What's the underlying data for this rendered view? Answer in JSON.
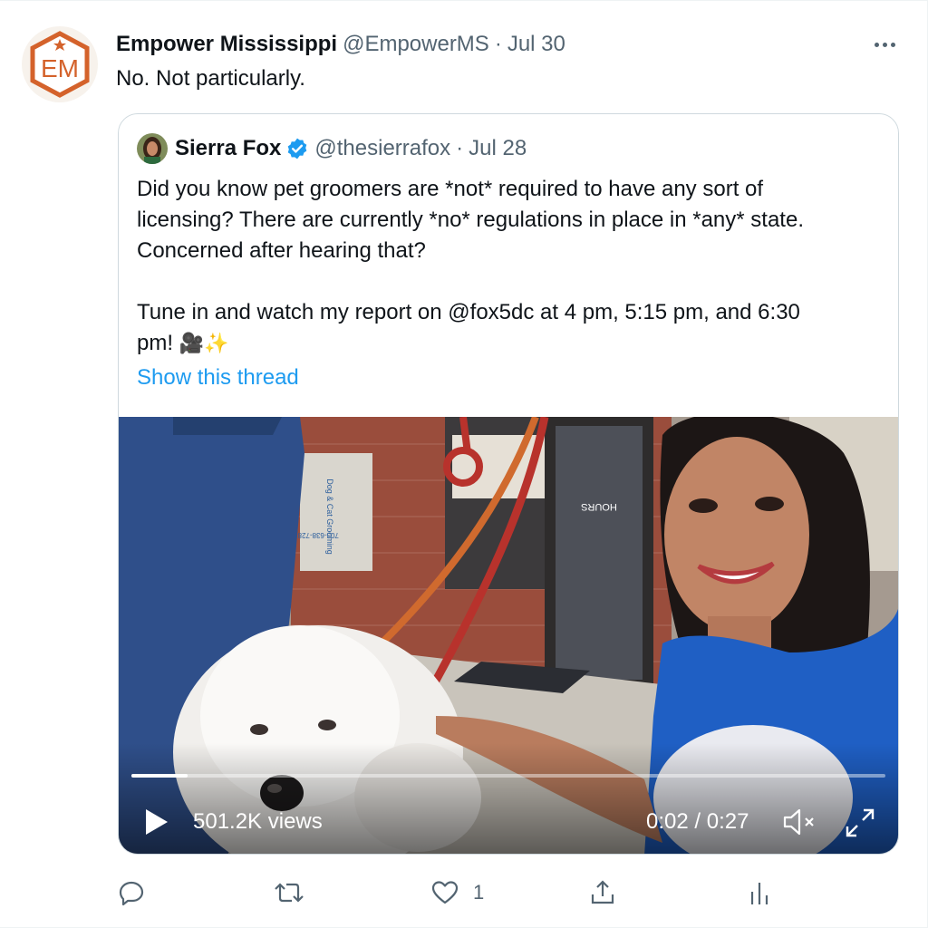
{
  "tweet": {
    "author_name": "Empower Mississippi",
    "author_handle": "@EmpowerMS",
    "separator": "·",
    "date": "Jul 30",
    "text": "No. Not particularly.",
    "avatar_text": "EM",
    "avatar_icon": "empower-mississippi-logo",
    "menu_icon": "more-horizontal-icon"
  },
  "quoted_tweet": {
    "author_name": "Sierra Fox",
    "author_handle": "@thesierrafox",
    "separator": "·",
    "date": "Jul 28",
    "verified_icon": "verified-badge-icon",
    "text_line_1": "Did you know pet groomers are *not* required to have any sort of",
    "text_line_2": "licensing? There are currently *no* regulations in place in *any* state.",
    "text_line_3": "Concerned after hearing that?",
    "text_line_4": "Tune in and watch my report on @fox5dc at 4 pm, 5:15 pm, and 6:30",
    "text_line_5": "pm!",
    "emoji": "🎥✨",
    "show_thread": "Show this thread"
  },
  "video": {
    "views": "501.2K views",
    "time": "0:02 / 0:27",
    "progress": 0.074,
    "play_icon": "play-icon",
    "mute_icon": "volume-muted-icon",
    "fullscreen_icon": "fullscreen-icon",
    "sign_text_1": "HOURS",
    "sign_text_2": "Dog & Cat Grooming",
    "sign_text_3": "703-638-7283"
  },
  "actions": {
    "reply_icon": "reply-icon",
    "retweet_icon": "retweet-icon",
    "like_icon": "heart-icon",
    "like_count": "1",
    "share_icon": "share-icon",
    "analytics_icon": "analytics-icon"
  },
  "colors": {
    "brand_orange": "#d4622b",
    "link_blue": "#1d9bf0",
    "secondary_text": "#536471",
    "border": "#cfd9de",
    "shirt_blue": "#1f5fc4"
  }
}
